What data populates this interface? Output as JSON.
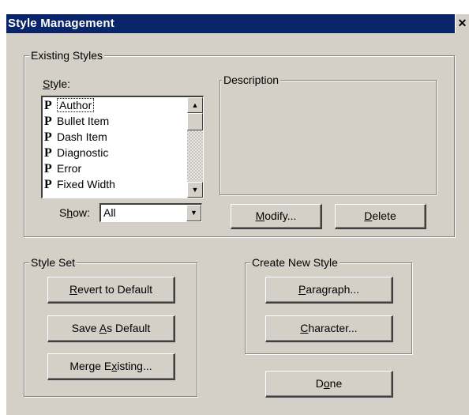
{
  "window": {
    "title": "Style Management",
    "close_glyph": "✕"
  },
  "existing_styles": {
    "group_label": "Existing Styles",
    "style_label_u": "S",
    "style_label_rest": "tyle:",
    "list_marker": "P",
    "styles": [
      "Author",
      "Bullet Item",
      "Dash Item",
      "Diagnostic",
      "Error",
      "Fixed Width"
    ],
    "selected": "Author",
    "show_label_a": "S",
    "show_label_u": "h",
    "show_label_b": "ow:",
    "show_value": "All",
    "description_label": "Description",
    "modify_u": "M",
    "modify_rest": "odify...",
    "delete_u": "D",
    "delete_rest": "elete"
  },
  "style_set": {
    "group_label": "Style Set",
    "revert_u": "R",
    "revert_rest": "evert to Default",
    "save_a": "Save ",
    "save_u": "A",
    "save_b": "s Default",
    "merge_a": "Merge E",
    "merge_u": "x",
    "merge_b": "isting..."
  },
  "create_new": {
    "group_label": "Create New Style",
    "paragraph_u": "P",
    "paragraph_rest": "aragraph...",
    "character_u": "C",
    "character_rest": "haracter..."
  },
  "done": {
    "a": "D",
    "u": "o",
    "b": "ne"
  },
  "icons": {
    "scroll_up": "up-arrow-icon",
    "scroll_down": "down-arrow-icon",
    "dropdown": "dropdown-arrow-icon"
  }
}
